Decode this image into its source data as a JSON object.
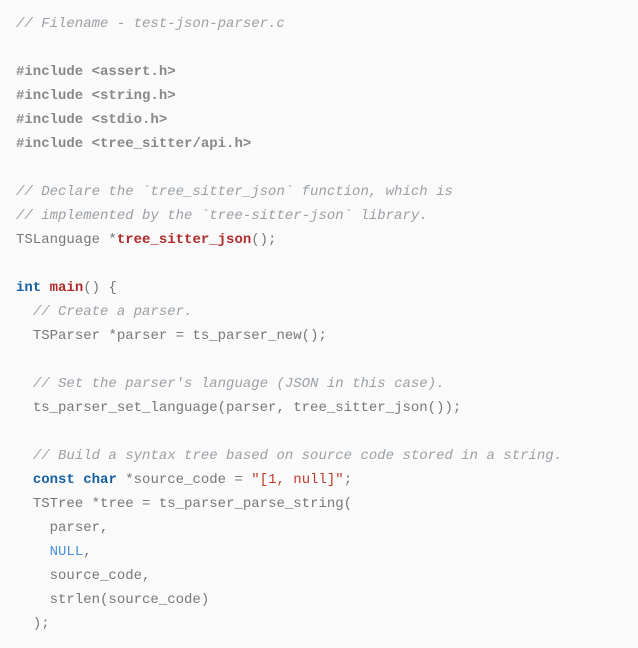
{
  "code": {
    "c_filename": "// Filename - test-json-parser.c",
    "inc": "#include",
    "h_assert": "<assert.h>",
    "h_string": "<string.h>",
    "h_stdio": "<stdio.h>",
    "h_treesitter": "<tree_sitter/api.h>",
    "c_decl1": "// Declare the `tree_sitter_json` function, which is",
    "c_decl2": "// implemented by the `tree-sitter-json` library.",
    "ty_tslang": "TSLanguage",
    "star": "*",
    "fn_tsjson": "tree_sitter_json",
    "parens_semi": "();",
    "ty_int": "int",
    "fn_main": "main",
    "main_open": "() {",
    "c_create": "// Create a parser.",
    "ty_tsparser": "TSParser",
    "id_parser_decl": "*parser = ts_parser_new();",
    "c_setlang": "// Set the parser's language (JSON in this case).",
    "call_setlang": "ts_parser_set_language(parser, tree_sitter_json());",
    "c_build": "// Build a syntax tree based on source code stored in a string.",
    "kw_const": "const",
    "kw_char": "char",
    "id_srcdecl_pre": "*source_code = ",
    "str_srccode": "\"[1, null]\"",
    "semi": ";",
    "ty_tstree": "TSTree",
    "id_tree_decl": "*tree = ts_parser_parse_string(",
    "arg_parser": "parser,",
    "arg_null": "NULL",
    "comma": ",",
    "arg_srccode": "source_code,",
    "arg_strlen": "strlen(source_code)",
    "close_call": ");"
  }
}
